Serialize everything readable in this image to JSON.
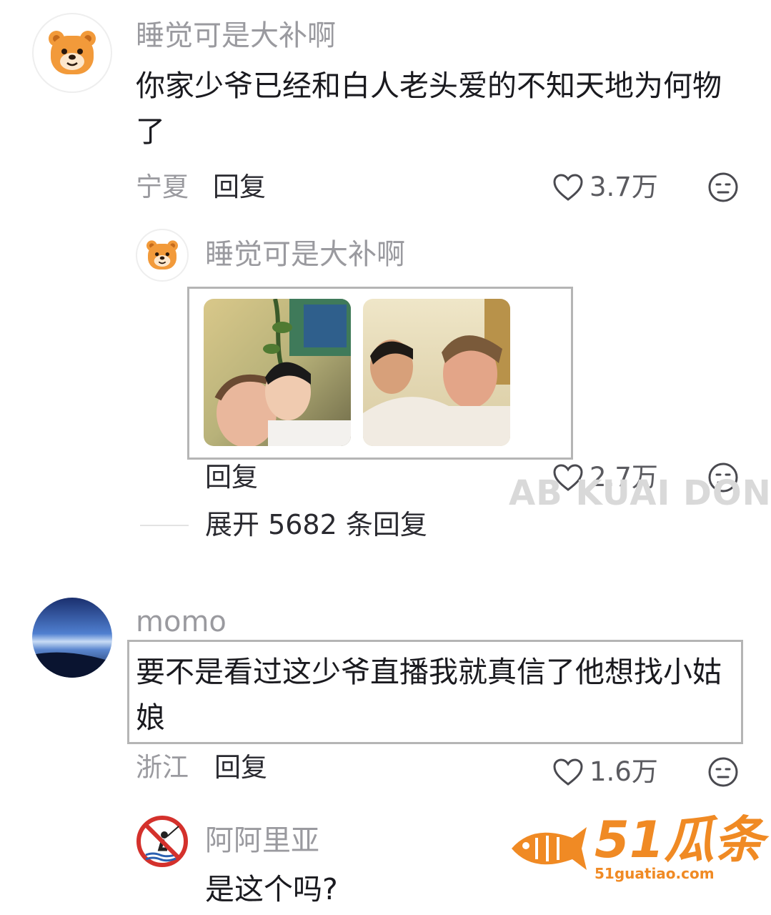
{
  "comments": [
    {
      "username": "睡觉可是大补啊",
      "text": "你家少爷已经和白人老头爱的不知天地为何物了",
      "location": "宁夏",
      "reply_label": "回复",
      "likes": "3.7万",
      "avatar_icon": "bear-avatar-icon",
      "replies": [
        {
          "username": "睡觉可是大补啊",
          "images": [
            "selfie-photo-1",
            "selfie-photo-2"
          ],
          "reply_label": "回复",
          "likes": "2.7万"
        }
      ],
      "expand_label": "展开 5682 条回复"
    },
    {
      "username": "momo",
      "text": "要不是看过这少爷直播我就真信了他想找小姑娘",
      "location": "浙江",
      "reply_label": "回复",
      "likes": "1.6万",
      "avatar_icon": "sky-avatar-icon",
      "replies": [
        {
          "username": "阿阿里亚",
          "text": "是这个吗?",
          "avatar_icon": "no-fishing-sign-icon"
        }
      ]
    }
  ],
  "watermarks": {
    "ab": "AB KUAI DONG",
    "brand_big": "51瓜条",
    "brand_url": "51guatiao.com"
  },
  "colors": {
    "text_primary": "#1a1a1f",
    "text_secondary": "#9a9a9f",
    "bear_orange": "#f29a3a",
    "brand_orange": "#f08a24"
  }
}
